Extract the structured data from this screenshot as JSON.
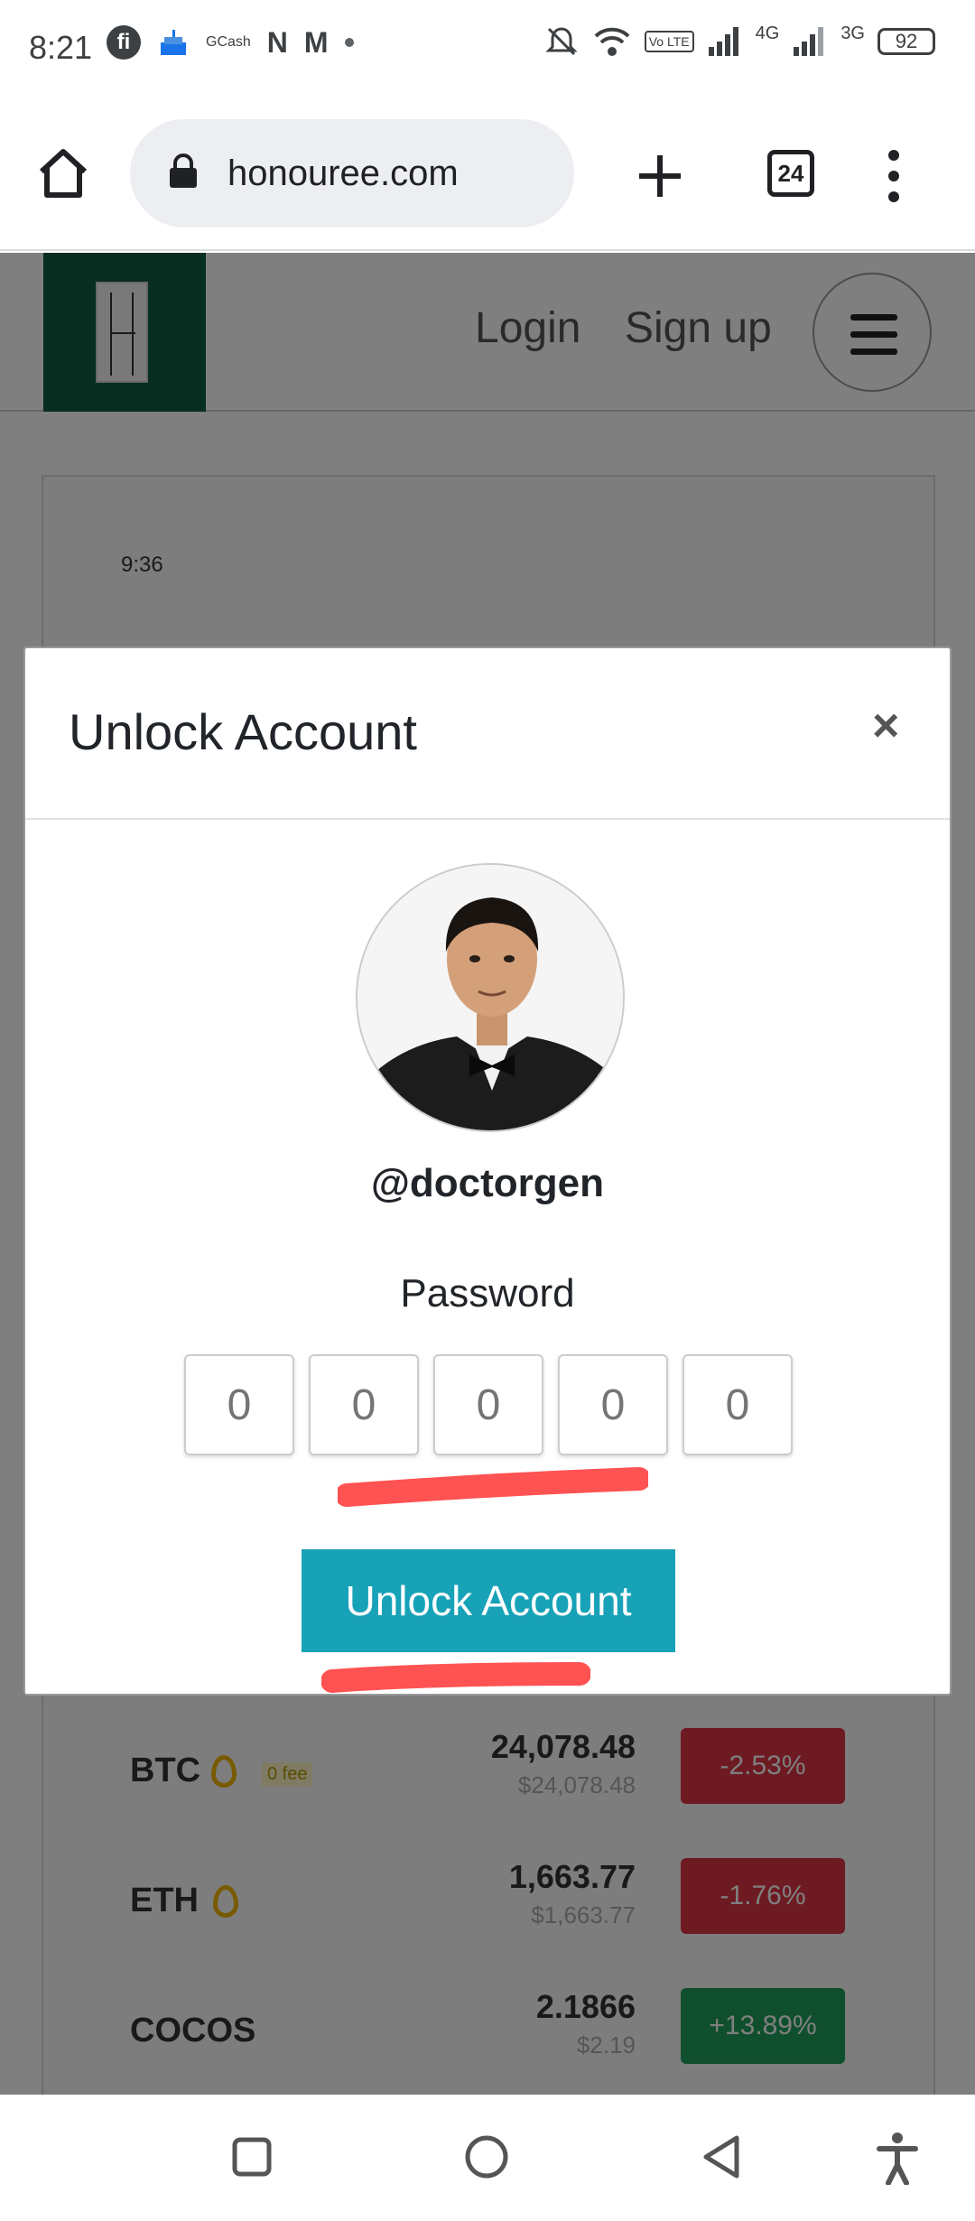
{
  "status_bar": {
    "time": "8:21",
    "fi_label": "fi",
    "gcash_label": "GCash",
    "n_label": "N",
    "m_label": "M",
    "volte_label": "Vo LTE",
    "net1_label": "4G",
    "net2_label": "3G",
    "battery": "92"
  },
  "browser": {
    "url": "honouree.com",
    "tab_count": "24"
  },
  "site": {
    "nav_login": "Login",
    "nav_signup": "Sign up",
    "embedded_status_time": "9:36",
    "coins": [
      {
        "name": "BTC",
        "fee": "0 fee",
        "price": "24,078.48",
        "sub": "$24,078.48",
        "change": "-2.53%"
      },
      {
        "name": "ETH",
        "price": "1,663.77",
        "sub": "$1,663.77",
        "change": "-1.76%"
      },
      {
        "name": "COCOS",
        "price": "2.1866",
        "sub": "$2.19",
        "change": "+13.89%"
      }
    ]
  },
  "modal": {
    "title": "Unlock Account",
    "close_label": "×",
    "username": "@doctorgen",
    "password_label": "Password",
    "pin_placeholder": "0",
    "unlock_label": "Unlock Account"
  },
  "colors": {
    "accent": "#17a2b8",
    "brand": "#0f5c42",
    "annotation": "#ff5252",
    "negative": "#dc3545",
    "positive": "#1e9e5a"
  }
}
